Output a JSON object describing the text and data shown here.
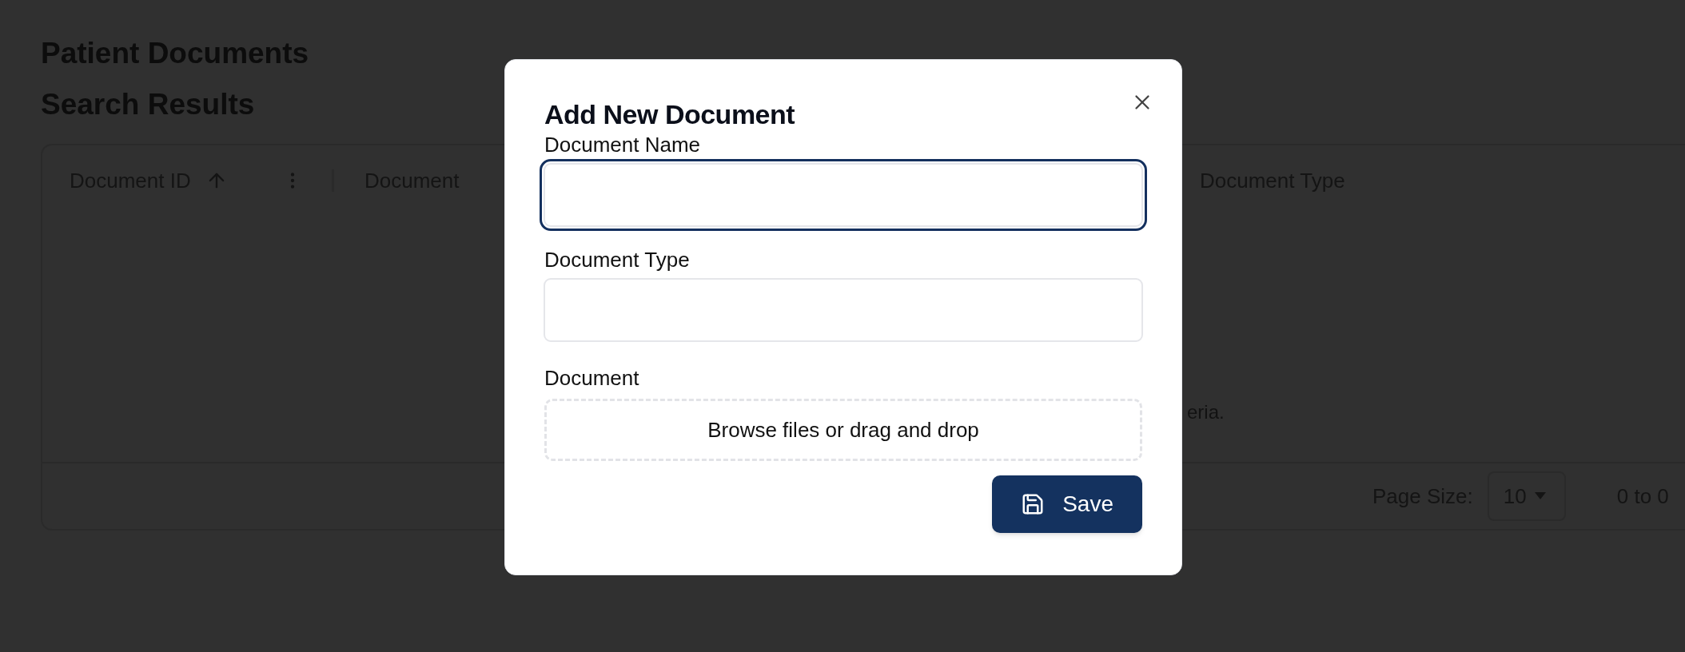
{
  "page": {
    "title": "Patient Documents",
    "subtitle": "Search Results"
  },
  "table": {
    "columns": [
      {
        "label": "Document ID",
        "sorted": true,
        "menu": true
      },
      {
        "label": "Document"
      },
      {
        "label": "Document Type"
      }
    ],
    "empty_message": "eria.",
    "footer": {
      "page_size_label": "Page Size:",
      "page_size": "10",
      "range": "0 to 0"
    }
  },
  "dialog": {
    "title": "Add New Document",
    "fields": [
      {
        "kind": "text",
        "label": "Document Name",
        "focused": true
      },
      {
        "kind": "text",
        "label": "Document Type",
        "focused": false
      },
      {
        "kind": "file",
        "label": "Document",
        "prompt": "Browse files or drag and drop"
      }
    ],
    "save_button": "Save"
  }
}
